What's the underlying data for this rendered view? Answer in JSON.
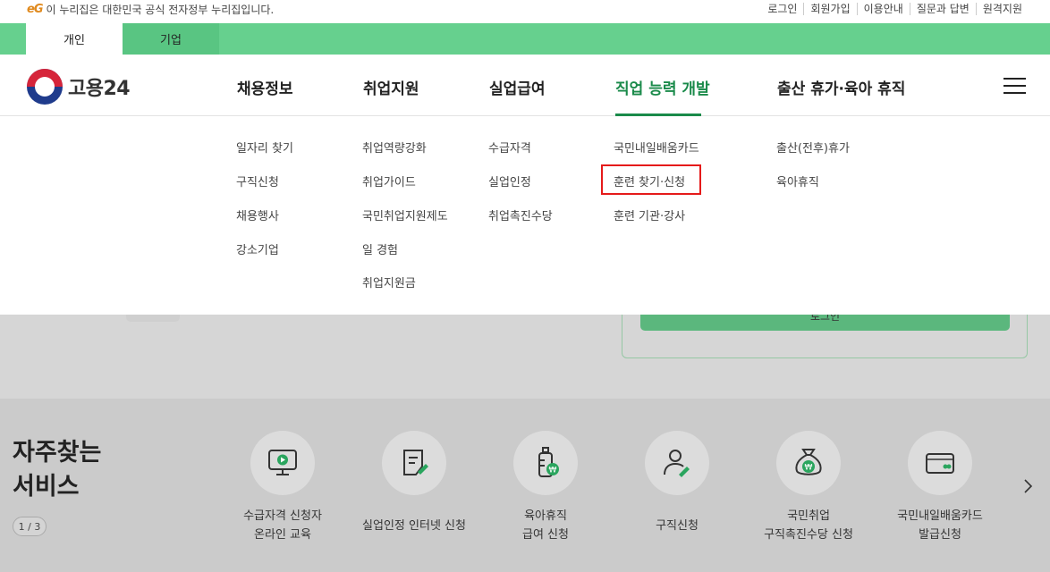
{
  "util_bar": {
    "gov_badge": "eG",
    "gov_text": "이 누리집은 대한민국 공식 전자정부 누리집입니다.",
    "links": [
      "로그인",
      "회원가입",
      "이용안내",
      "질문과 답변",
      "원격지원"
    ]
  },
  "tabs": [
    {
      "label": "개인",
      "active": true
    },
    {
      "label": "기업",
      "active": false
    }
  ],
  "logo": {
    "text": "고용24"
  },
  "gnb": [
    {
      "label": "채용정보",
      "active": false,
      "sub": [
        "일자리 찾기",
        "구직신청",
        "채용행사",
        "강소기업"
      ]
    },
    {
      "label": "취업지원",
      "active": false,
      "sub": [
        "취업역량강화",
        "취업가이드",
        "국민취업지원제도",
        "일 경험",
        "취업지원금"
      ]
    },
    {
      "label": "실업급여",
      "active": false,
      "sub": [
        "수급자격",
        "실업인정",
        "취업촉진수당"
      ]
    },
    {
      "label": "직업 능력 개발",
      "active": true,
      "sub": [
        "국민내일배움카드",
        "훈련 찾기·신청",
        "훈련 기관·강사"
      ]
    },
    {
      "label": "출산 휴가·육아 휴직",
      "active": false,
      "sub": [
        "출산(전후)휴가",
        "육아휴직"
      ]
    }
  ],
  "highlighted_item": "훈련 찾기·신청",
  "hidden_button": "로그인",
  "favorites": {
    "title_line1": "자주찾는",
    "title_line2": "서비스",
    "pager": "1 / 3",
    "items": [
      {
        "icon": "monitor-play-icon",
        "line1": "수급자격 신청자",
        "line2": "온라인 교육"
      },
      {
        "icon": "document-pen-icon",
        "line1": "실업인정 인터넷 신청",
        "line2": ""
      },
      {
        "icon": "baby-bottle-won-icon",
        "line1": "육아휴직",
        "line2": "급여 신청"
      },
      {
        "icon": "person-pen-icon",
        "line1": "구직신청",
        "line2": ""
      },
      {
        "icon": "money-bag-won-icon",
        "line1": "국민취업",
        "line2": "구직촉진수당 신청"
      },
      {
        "icon": "card-icon",
        "line1": "국민내일배움카드",
        "line2": "발급신청"
      }
    ]
  },
  "colors": {
    "brand_green": "#66d08e",
    "active_menu": "#1a8a4a",
    "highlight": "#e51a1a"
  }
}
